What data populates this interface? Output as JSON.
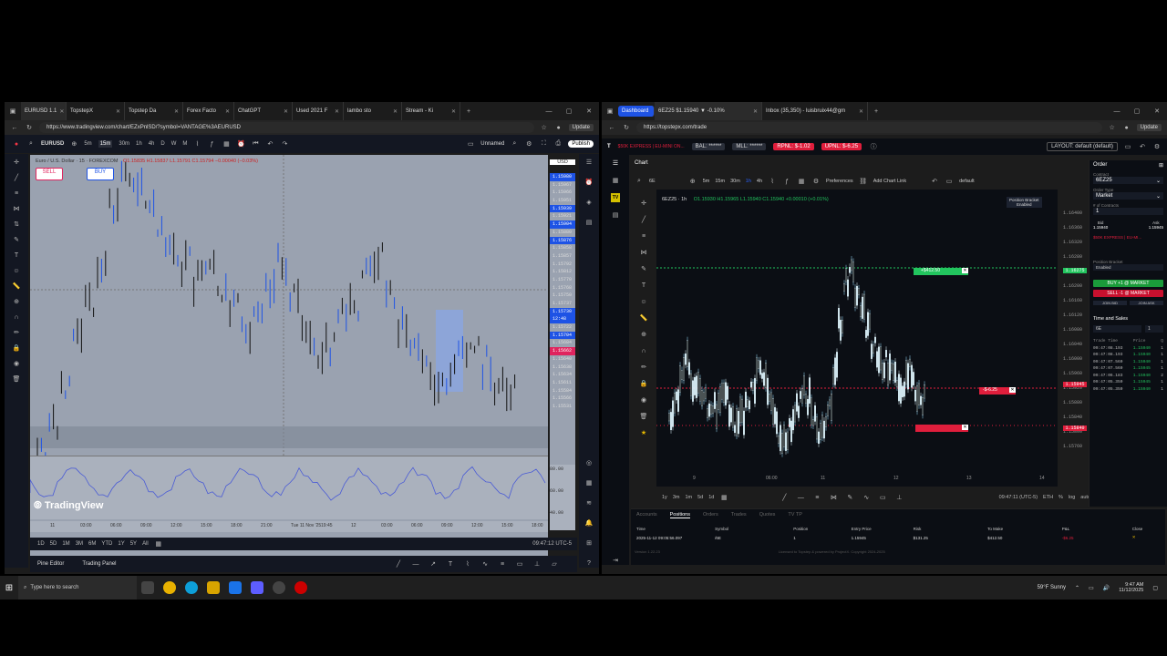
{
  "left_browser": {
    "tabs": [
      {
        "label": "EURUSD 1.1",
        "active": true
      },
      {
        "label": "TopstepX"
      },
      {
        "label": "Topstep Da"
      },
      {
        "label": "Forex Facto"
      },
      {
        "label": "ChatGPT"
      },
      {
        "label": "Used 2021 F"
      },
      {
        "label": "lambo sto"
      },
      {
        "label": "Stream - Ki"
      }
    ],
    "url": "https://www.tradingview.com/chart/EZxPnlSD/?symbol=VANTAGE%3AEURUSD",
    "update_label": "Update"
  },
  "tradingview": {
    "symbol": "EURUSD",
    "timeframes": [
      "5m",
      "15m",
      "30m",
      "1h",
      "4h",
      "D",
      "W",
      "M"
    ],
    "layout_name": "Unnamed",
    "publish_label": "Publish",
    "legend_title": "Euro / U.S. Dollar · 15 · FOREXCOM",
    "legend_ohlc": "O1.15835 H1.15837 L1.15791 C1.15794 −0.00040 (−0.03%)",
    "sell_label": "SELL",
    "buy_label": "BUY",
    "currency": "USD",
    "prices": [
      "1.15980",
      "1.15967",
      "1.15966",
      "1.15951",
      "1.15939",
      "1.15921",
      "1.15904",
      "1.15880",
      "1.15876",
      "1.15858",
      "1.15857",
      "1.15792",
      "1.15812",
      "1.15770",
      "1.15768",
      "1.15750",
      "1.15737",
      "1.15730",
      "12:48",
      "1.15722",
      "1.15704",
      "1.15684",
      "1.15662",
      "1.15640",
      "1.15638",
      "1.15634",
      "1.15611",
      "1.15584",
      "1.15566",
      "1.15531"
    ],
    "prices_blue_idx": [
      0,
      4,
      6,
      8,
      17,
      18,
      20
    ],
    "prices_red_idx": [
      22
    ],
    "osc_levels": [
      "80.00",
      "60.00",
      "40.00"
    ],
    "time_labels": [
      "11",
      "03:00",
      "06:00",
      "09:00",
      "12:00",
      "15:00",
      "18:00",
      "21:00",
      "Tue 11 Nov '25",
      "19:45",
      "12",
      "03:00",
      "06:00",
      "09:00",
      "12:00",
      "15:00",
      "18:00"
    ],
    "ranges": [
      "1D",
      "5D",
      "1M",
      "3M",
      "6M",
      "YTD",
      "1Y",
      "5Y",
      "All"
    ],
    "clock": "09:47:12 UTC-5",
    "bottom_tabs": [
      "Pine Editor",
      "Trading Panel"
    ],
    "logo_text": "TradingView"
  },
  "right_browser": {
    "tabs": [
      {
        "label": "Dashboard"
      },
      {
        "label": "6EZ25 $1.15940 ▼ -0.10%",
        "active": true
      },
      {
        "label": "Inbox (35,350) - luisbruix44@gm"
      }
    ],
    "url": "https://topstepx.com/trade",
    "update_label": "Update"
  },
  "topstep": {
    "account": "$50K EXPRESS | EU-MINI ON...",
    "bal": "BAL: ******",
    "mll": "MLL: ******",
    "rpnl": "RPNL: $-1.02",
    "upnl": "UPNL: $-6.25",
    "layout": "LAYOUT: default (default)",
    "chart_label": "Chart",
    "symbol": "6E",
    "timeframes": [
      "5m",
      "15m",
      "30m",
      "1h",
      "4h"
    ],
    "preferences": "Preferences",
    "add_chart_link": "Add Chart Link",
    "default_label": "default",
    "chart_legend": "6EZ25 · 1h",
    "chart_ohlc": "O1.15930 H1.15965 L1.15940 C1.15940 +0.00010 (+0.01%)",
    "position_bracket": "Position Bracket",
    "position_bracket_state": "Enabled",
    "prices": [
      "1.16400",
      "1.16360",
      "1.16320",
      "1.16280",
      "1.16240",
      "1.16200",
      "1.16160",
      "1.16120",
      "1.16080",
      "1.16040",
      "1.16000",
      "1.15960",
      "1.15920",
      "1.15880",
      "1.15840",
      "1.15800",
      "1.15760"
    ],
    "tp_label": "+$412.50",
    "entry_label": "-$-6.25",
    "sl_label": "",
    "tp_price": "1.16275",
    "entry_price": "1.15945",
    "sl_price": "1.15840",
    "time_labels": [
      "9",
      "06:00",
      "11",
      "12",
      "13",
      "14"
    ],
    "ranges": [
      "1y",
      "3m",
      "1m",
      "5d",
      "1d"
    ],
    "clock": "09:47:11 (UTC-5)",
    "eth": "ETH",
    "pct": "%",
    "log": "log",
    "auto": "auto",
    "bottom_tabs": [
      "Accounts",
      "Positions",
      "Orders",
      "Trades",
      "Quotes",
      "TV TP"
    ],
    "positions_headers": [
      "Time",
      "Symbol",
      "Position",
      "Entry Price",
      "Risk",
      "To Make",
      "P&L",
      "Close"
    ],
    "position_row": [
      "2025-11-12 09:05:56.097",
      "/6E",
      "1",
      "1.15945",
      "$131.25",
      "$412.50",
      "-$6.25",
      "✕"
    ],
    "footer_left": "Version 1.22.23",
    "footer_center": "Licensed to Topstep & powered by ProjectX. Copyright 2024-2025"
  },
  "order_panel": {
    "title": "Order",
    "contract_label": "Contract",
    "contract": "6EZ25",
    "order_type_label": "Order Type",
    "order_type": "Market",
    "contracts_label": "# of Contracts",
    "contracts": "1",
    "bid_label": "Bid",
    "ask_label": "Ask",
    "bid": "1.15940",
    "ask": "1.15945",
    "account": "$50K EXPRESS | EU-MI...",
    "position_bracket_label": "Position Bracket",
    "position_bracket_value": "Enabled",
    "buy_btn": "BUY +1 @ MARKET",
    "sell_btn": "SELL -1 @ MARKET",
    "join_bid": "JOIN BID",
    "join_ask": "JOIN ASK",
    "ts_title": "Time and Sales",
    "ts_contract": "6E",
    "ts_size": "1",
    "ts_headers": [
      "Trade Time",
      "Price",
      "Q"
    ],
    "ts_rows": [
      [
        "09:47:08.193",
        "1.15940",
        "1"
      ],
      [
        "09:47:08.193",
        "1.15940",
        "1"
      ],
      [
        "09:47:07.560",
        "1.15940",
        "1"
      ],
      [
        "09:47:07.560",
        "1.15945",
        "1"
      ],
      [
        "09:47:06.183",
        "1.15940",
        "2"
      ],
      [
        "09:47:05.350",
        "1.15945",
        "1"
      ],
      [
        "09:47:05.350",
        "1.15940",
        "1"
      ]
    ]
  },
  "taskbar": {
    "search_placeholder": "Type here to search",
    "weather": "59°F  Sunny",
    "time": "9:47 AM",
    "date": "11/12/2025"
  },
  "colors": {
    "tv_bg": "#9aa2b0",
    "topstep_bg": "#0b0e14",
    "bull": "#e0f7ff",
    "bear": "#0a0a0a",
    "accent_blue": "#1e53e5",
    "green": "#22c55e",
    "red": "#e01e3c"
  }
}
